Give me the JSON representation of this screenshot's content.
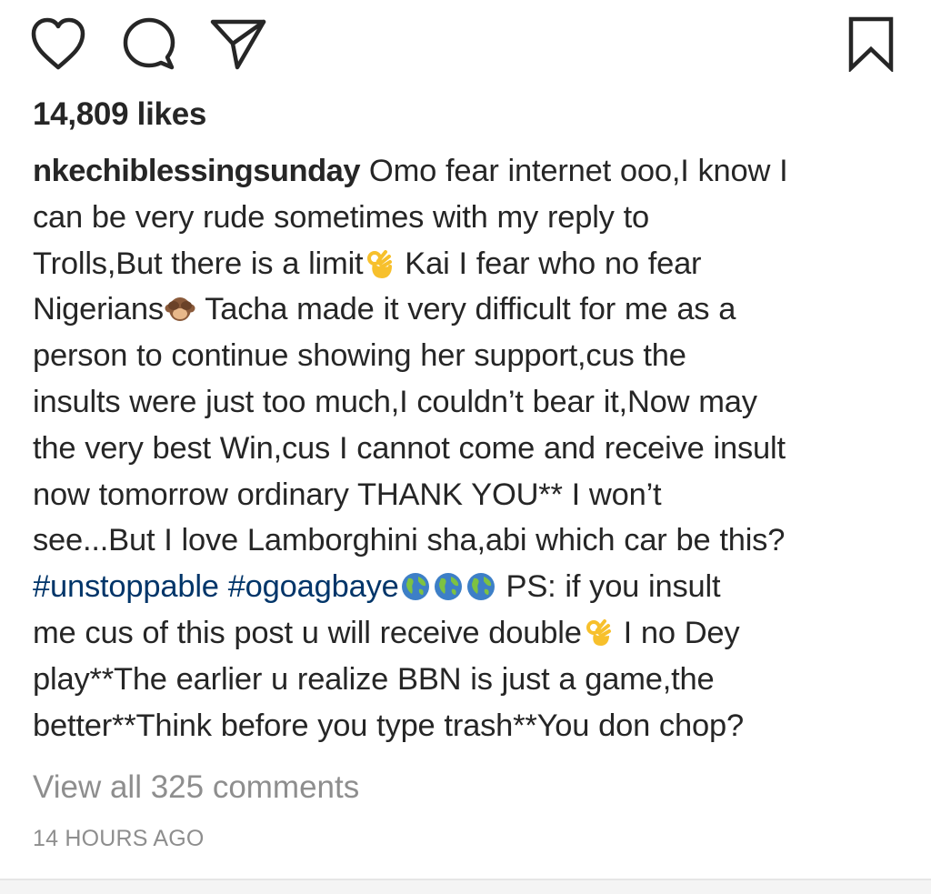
{
  "actions": {
    "like_icon": "heart-outline",
    "comment_icon": "speech-bubble-outline",
    "share_icon": "paper-plane-outline",
    "save_icon": "bookmark-outline"
  },
  "post": {
    "likes": "14,809 likes",
    "username": "nkechiblessingsunday",
    "caption": {
      "line1": " Omo fear internet ooo,I know I",
      "line2": "can be very rude sometimes with my reply to",
      "line3a": "Trolls,But there is a limit",
      "line3b": " Kai I fear who no fear",
      "line4a": "Nigerians",
      "line4b": " Tacha made it very difficult for me as a",
      "line5": "person to continue showing her support,cus the",
      "line6": "insults were just too much,I couldn’t bear it,Now may",
      "line7": "the very best Win,cus I cannot come and receive insult",
      "line8": "now tomorrow ordinary THANK YOU** I won’t",
      "line9": "see...But I love Lamborghini sha,abi which car be this?",
      "hashtag1": "#unstoppable",
      "hashtag2": "#ogoagbaye",
      "line10b": " PS: if you insult",
      "line11a": "me cus of this post u will receive double",
      "line11b": " I no Dey",
      "line12": "play**The earlier u realize BBN is just a game,the",
      "line13": "better**Think before you type trash**You don chop?"
    },
    "emojis": {
      "ok_hand": "ok-hand-emoji",
      "monkey": "see-no-evil-monkey-emoji",
      "globe": "globe-africa-emoji"
    },
    "view_comments": "View all 325 comments",
    "timestamp": "14 HOURS AGO"
  },
  "colors": {
    "text": "#262626",
    "hashtag": "#003569",
    "muted": "#8e8e8e",
    "emoji_yellow": "#f7c02c",
    "emoji_brown": "#8a5a3a",
    "globe_blue": "#3d7fc7",
    "globe_green": "#7dc242"
  }
}
